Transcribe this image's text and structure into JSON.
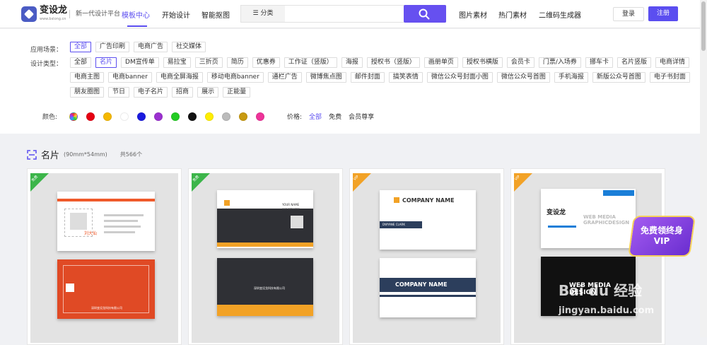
{
  "brand": {
    "name": "变设龙",
    "domain": "www.bslong.cn",
    "slogan": "新一代设计平台"
  },
  "nav": [
    "模板中心",
    "开始设计",
    "智能抠图"
  ],
  "search": {
    "category": "分类",
    "placeholder": ""
  },
  "right_nav": [
    "图片素材",
    "热门素材",
    "二维码生成器"
  ],
  "auth": {
    "login": "登录",
    "register": "注册"
  },
  "filters": {
    "scene_label": "应用场景：",
    "scenes": [
      "全部",
      "广告印刷",
      "电商广告",
      "社交媒体"
    ],
    "type_label": "设计类型：",
    "types": [
      "全部",
      "名片",
      "DM宣传单",
      "易拉宝",
      "三折页",
      "简历",
      "优惠券",
      "工作证（竖版）",
      "海报",
      "授权书（竖版）",
      "画册单页",
      "授权书横版",
      "会员卡",
      "门票/入场券",
      "挪车卡",
      "名片竖版",
      "电商详情",
      "电商主图",
      "电商banner",
      "电商全屏海报",
      "移动电商banner",
      "通栏广告",
      "微博焦点图",
      "邮件封面",
      "搞笑表情",
      "微信公众号封面小图",
      "微信公众号首图",
      "手机海报",
      "新版公众号首图",
      "电子书封面",
      "朋友圈图",
      "节日",
      "电子名片",
      "招商",
      "展示",
      "正能量"
    ],
    "color_label": "颜色:",
    "colors": [
      "#8844cc",
      "#e60012",
      "#f5b800",
      "#ffffff",
      "#1a1adf",
      "#9b30d0",
      "#22cc22",
      "#111111",
      "#ffee00",
      "#bbbbbb",
      "#c89a10",
      "#ee3399"
    ],
    "price_label": "价格:",
    "prices": [
      "全部",
      "免费",
      "会员尊享"
    ]
  },
  "section": {
    "title": "名片",
    "size": "(90mm*54mm)",
    "count": "共566个"
  },
  "cards": [
    {
      "badge": "免费",
      "front_name": "刘大仙",
      "front_role": "总经理",
      "back_company": "深圳变设龙科技有限公司"
    },
    {
      "badge": "免费",
      "front_name": "YOUR NAME",
      "front_role": "VICE PRESIDENT",
      "back_company": "深圳变设龙科技有限公司"
    },
    {
      "badge": "VIP",
      "front_name": "COMPANY NAME",
      "front_role": "DWYANE CLARK",
      "back_company": "COMPANY NAME"
    },
    {
      "badge": "VIP",
      "front_name": "变设龙",
      "front_role": "WEB MEDIA GRAPHICDESIGN",
      "back_company": "WEB MEDIA DESIGN"
    }
  ],
  "overlay": {
    "vip_badge": "免费领终身VIP",
    "watermark": "Bai du 经验",
    "watermark_url": "jingyan.baidu.com"
  }
}
